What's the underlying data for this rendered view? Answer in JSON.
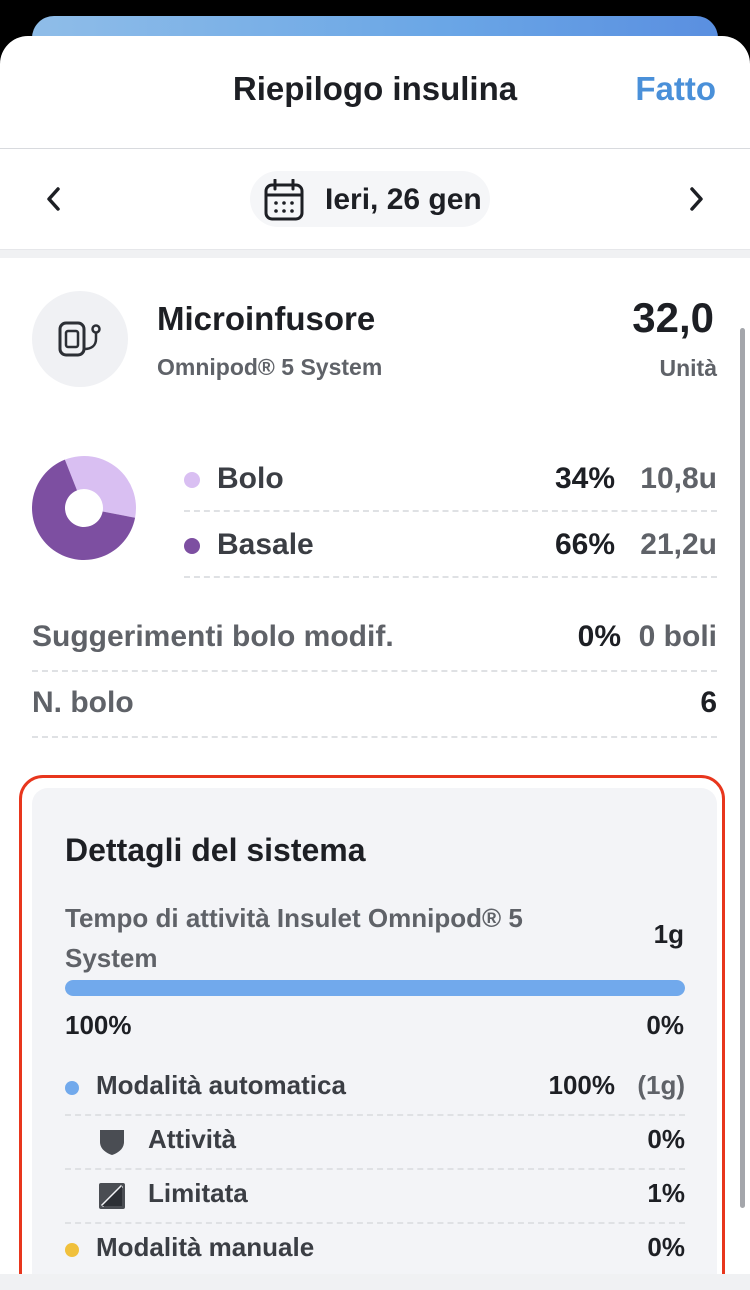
{
  "header": {
    "title": "Riepilogo insulina",
    "done_label": "Fatto"
  },
  "date_nav": {
    "date_label": "Ieri, 26 gen",
    "prev_icon": "chevron-left-icon",
    "next_icon": "chevron-right-icon",
    "calendar_icon": "calendar-icon"
  },
  "device": {
    "name": "Microinfusore",
    "subtitle": "Omnipod® 5 System",
    "total_value": "32,0",
    "total_unit": "Unità",
    "icon": "insulin-pump-icon"
  },
  "distribution": {
    "rows": [
      {
        "label": "Bolo",
        "percent": "34%",
        "amount": "10,8u",
        "color": "#d9bff2",
        "fraction": 0.34
      },
      {
        "label": "Basale",
        "percent": "66%",
        "amount": "21,2u",
        "color": "#7d4fa1",
        "fraction": 0.66
      }
    ]
  },
  "stats": {
    "bolus_suggestions": {
      "label": "Suggerimenti bolo modif.",
      "percent": "0%",
      "amount": "0 boli"
    },
    "bolus_count": {
      "label": "N. bolo",
      "value": "6"
    }
  },
  "system_details": {
    "title": "Dettagli del sistema",
    "uptime_label": "Tempo di attività Insulet Omnipod® 5 System",
    "uptime_value": "1g",
    "progress_fraction": 1.0,
    "progress_left": "100%",
    "progress_right": "0%",
    "progress_color": "#71a9ec",
    "modes": {
      "automatic": {
        "label": "Modalità automatica",
        "percent": "100%",
        "days": "(1g)",
        "color": "#71a9ec"
      },
      "activity": {
        "label": "Attività",
        "percent": "0%",
        "icon": "shield-icon"
      },
      "limited": {
        "label": "Limitata",
        "percent": "1%",
        "icon": "half-square-icon"
      },
      "manual": {
        "label": "Modalità manuale",
        "percent": "0%",
        "color": "#f0c03c"
      }
    }
  },
  "colors": {
    "accent": "#4a90d9",
    "highlight_border": "#e8361d"
  }
}
